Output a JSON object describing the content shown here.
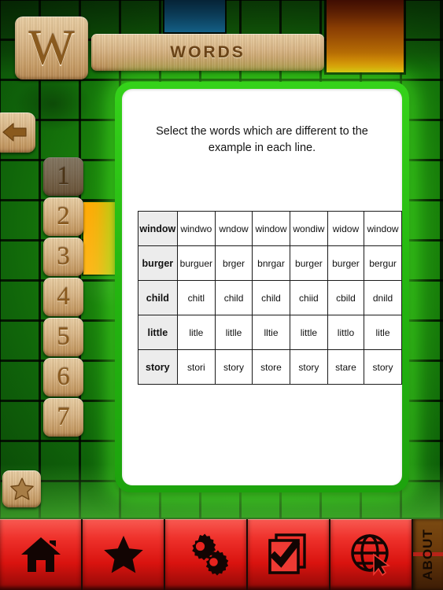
{
  "header": {
    "logo_letter": "W",
    "title": "WORDS"
  },
  "card": {
    "instructions": "Select the words which are different to the example in each line."
  },
  "left_rail": {
    "back_label": "back-arrow",
    "favorite_label": "star",
    "levels": [
      {
        "label": "1",
        "active": true
      },
      {
        "label": "2",
        "active": false
      },
      {
        "label": "3",
        "active": false
      },
      {
        "label": "4",
        "active": false
      },
      {
        "label": "5",
        "active": false
      },
      {
        "label": "6",
        "active": false
      },
      {
        "label": "7",
        "active": false
      }
    ]
  },
  "table": {
    "rows": [
      [
        "window",
        "windwo",
        "wndow",
        "window",
        "wondiw",
        "widow",
        "window"
      ],
      [
        "burger",
        "burguer",
        "brger",
        "bnrgar",
        "burger",
        "burger",
        "bergur"
      ],
      [
        "child",
        "chitl",
        "child",
        "child",
        "chiid",
        "cbild",
        "dnild"
      ],
      [
        "little",
        "litle",
        "litlle",
        "lltie",
        "little",
        "littlo",
        "litle"
      ],
      [
        "story",
        "stori",
        "story",
        "store",
        "story",
        "stare",
        "story"
      ]
    ]
  },
  "toolbar": {
    "buttons": [
      {
        "name": "home",
        "icon": "home-icon"
      },
      {
        "name": "favorites",
        "icon": "star-icon"
      },
      {
        "name": "settings",
        "icon": "gears-icon"
      },
      {
        "name": "tasks",
        "icon": "checkbox-document-icon"
      },
      {
        "name": "web",
        "icon": "globe-cursor-icon"
      }
    ],
    "about_label": "ABOUT"
  },
  "colors": {
    "board_green": "#1d8b0c",
    "card_glow_green": "#35d21a",
    "toolbar_red": "#d9130f",
    "wood": "#d7b383",
    "accent_orange": "#ffab08",
    "accent_blue": "#1f97d4"
  }
}
